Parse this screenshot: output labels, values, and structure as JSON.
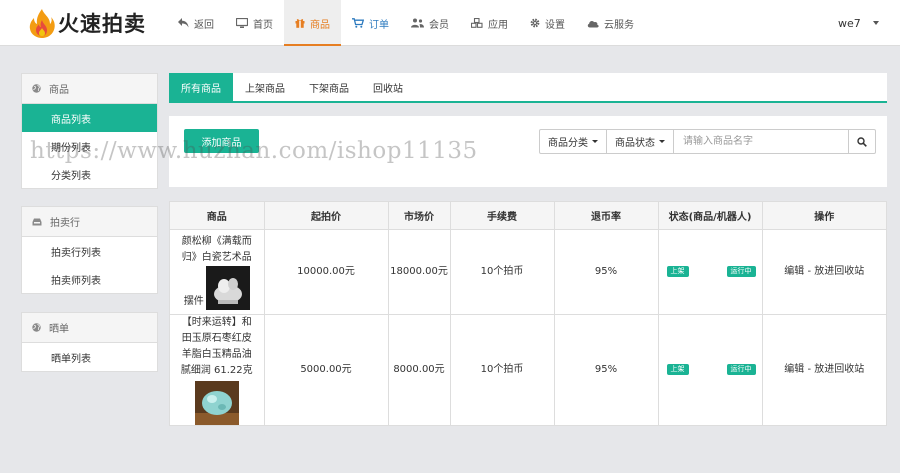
{
  "header": {
    "brand": "火速拍卖",
    "nav": [
      {
        "label": "返回",
        "icon": "reply-icon"
      },
      {
        "label": "首页",
        "icon": "desktop-icon"
      },
      {
        "label": "商品",
        "icon": "gift-icon"
      },
      {
        "label": "订单",
        "icon": "cart-icon"
      },
      {
        "label": "会员",
        "icon": "users-icon"
      },
      {
        "label": "应用",
        "icon": "cubes-icon"
      },
      {
        "label": "设置",
        "icon": "gear-icon"
      },
      {
        "label": "云服务",
        "icon": "cloud-icon"
      }
    ],
    "active_nav": "商品",
    "user": "we7"
  },
  "sidebar": {
    "groups": [
      {
        "title": "商品",
        "icon": "globe-icon",
        "items": [
          "商品列表",
          "期份列表",
          "分类列表"
        ]
      },
      {
        "title": "拍卖行",
        "icon": "inbox-icon",
        "items": [
          "拍卖行列表",
          "拍卖师列表"
        ]
      },
      {
        "title": "晒单",
        "icon": "globe-icon",
        "items": [
          "晒单列表"
        ]
      }
    ],
    "active_item": "商品列表"
  },
  "tabs": [
    "所有商品",
    "上架商品",
    "下架商品",
    "回收站"
  ],
  "active_tab": "所有商品",
  "toolbar": {
    "add_label": "添加商品",
    "category_label": "商品分类",
    "status_label": "商品状态",
    "search_placeholder": "请输入商品名字"
  },
  "watermark": "https://www.huzhan.com/ishop11135",
  "table": {
    "columns": [
      "商品",
      "起拍价",
      "市场价",
      "手续费",
      "退币率",
      "状态(商品/机器人)",
      "操作"
    ],
    "rows": [
      {
        "name": "颜松柳《满载而归》白瓷艺术品摆件",
        "start_price": "10000.00元",
        "market_price": "18000.00元",
        "fee": "10个拍币",
        "refund_rate": "95%",
        "status": "上架",
        "robot": "运行中",
        "actions": "编辑 - 放进回收站"
      },
      {
        "name": "【时来运转】和田玉原石枣红皮 羊脂白玉精品油腻细润 61.22克",
        "start_price": "5000.00元",
        "market_price": "8000.00元",
        "fee": "10个拍币",
        "refund_rate": "95%",
        "status": "上架",
        "robot": "运行中",
        "actions": "编辑 - 放进回收站"
      }
    ]
  },
  "colors": {
    "accent": "#1ab394",
    "nav_active": "#e67e22",
    "link": "#2e7bbf"
  }
}
